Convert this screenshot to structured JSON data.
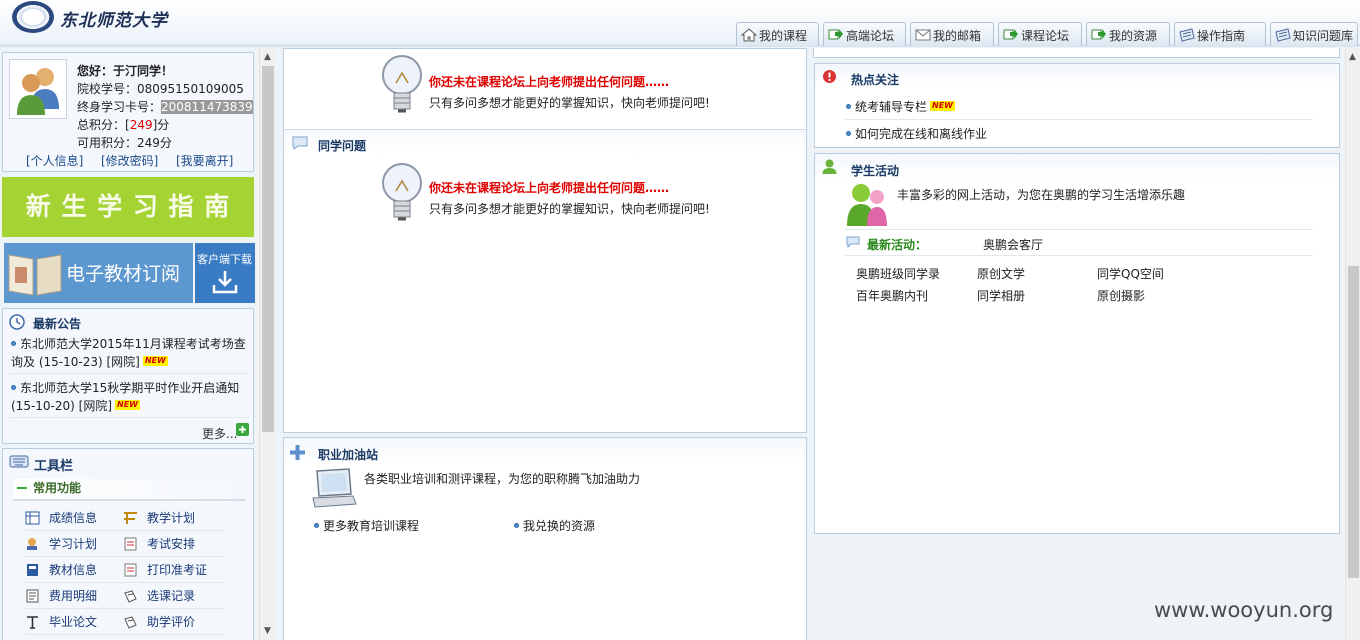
{
  "header": {
    "brand": "东北师范大学",
    "tabs": [
      {
        "label": "我的课程",
        "icon": "home-icon"
      },
      {
        "label": "高端论坛",
        "icon": "forum-arrow-icon"
      },
      {
        "label": "我的邮箱",
        "icon": "mail-icon"
      },
      {
        "label": "课程论坛",
        "icon": "forum-arrow-icon"
      },
      {
        "label": "我的资源",
        "icon": "resource-arrow-icon"
      },
      {
        "label": "操作指南",
        "icon": "guide-icon"
      },
      {
        "label": "知识问题库",
        "icon": "library-icon"
      }
    ]
  },
  "profile": {
    "greeting": "您好：于汀同学！",
    "school_id": "院校学号：08095150109005",
    "card_label": "终身学习卡号：",
    "card_value": "200811473839",
    "total_label": "总积分：[",
    "total_value": "249",
    "total_suffix": "]分",
    "avail": "可用积分：249分",
    "links": [
      "[个人信息]",
      "[修改密码]",
      "[我要离开]"
    ]
  },
  "banners": {
    "guide": "新 生 学 习 指 南",
    "textbook": "电子教材订阅",
    "client": "客户端下载"
  },
  "announcements": {
    "title": "最新公告",
    "items": [
      {
        "line1": "东北师范大学2015年11月课程考试考场查",
        "line2": "询及 (15-10-23) [网院]",
        "badge": "NEW"
      },
      {
        "line1": "东北师范大学15秋学期平时作业开启通知",
        "line2": "(15-10-20) [网院]",
        "badge": "NEW"
      }
    ],
    "more": "更多..."
  },
  "toolbar": {
    "title": "工具栏",
    "section": "常用功能",
    "items": [
      {
        "label": "成绩信息",
        "icon": "grade-icon"
      },
      {
        "label": "教学计划",
        "icon": "plan-icon"
      },
      {
        "label": "学习计划",
        "icon": "study-plan-icon"
      },
      {
        "label": "考试安排",
        "icon": "exam-icon"
      },
      {
        "label": "教材信息",
        "icon": "book-icon"
      },
      {
        "label": "打印准考证",
        "icon": "print-icon"
      },
      {
        "label": "费用明细",
        "icon": "fee-icon"
      },
      {
        "label": "选课记录",
        "icon": "record-icon"
      },
      {
        "label": "毕业论文",
        "icon": "thesis-icon"
      },
      {
        "label": "助学评价",
        "icon": "evaluation-icon"
      }
    ]
  },
  "questions": {
    "top_red": "你还未在课程论坛上向老师提出任何问题……",
    "top_sub": "只有多问多想才能更好的掌握知识，快向老师提问吧!",
    "peer_title": "同学问题",
    "peer_red": "你还未在课程论坛上向老师提出任何问题……",
    "peer_sub": "只有多问多想才能更好的掌握知识，快向老师提问吧!"
  },
  "career": {
    "title": "职业加油站",
    "desc": "各类职业培训和测评课程，为您的职称腾飞加油助力",
    "links": [
      "更多教育培训课程",
      "我兑换的资源"
    ]
  },
  "hot": {
    "title": "热点关注",
    "items": [
      {
        "label": "统考辅导专栏",
        "badge": "NEW"
      },
      {
        "label": "如何完成在线和离线作业"
      }
    ]
  },
  "activity": {
    "title": "学生活动",
    "desc": "丰富多彩的网上活动，为您在奥鹏的学习生活增添乐趣",
    "latest_label": "最新活动：",
    "latest_value": "奥鹏会客厅",
    "links": [
      "奥鹏班级同学录",
      "原创文学",
      "同学QQ空间",
      "百年奥鹏内刊",
      "同学相册",
      "原创摄影"
    ]
  },
  "watermark": "www.wooyun.org"
}
